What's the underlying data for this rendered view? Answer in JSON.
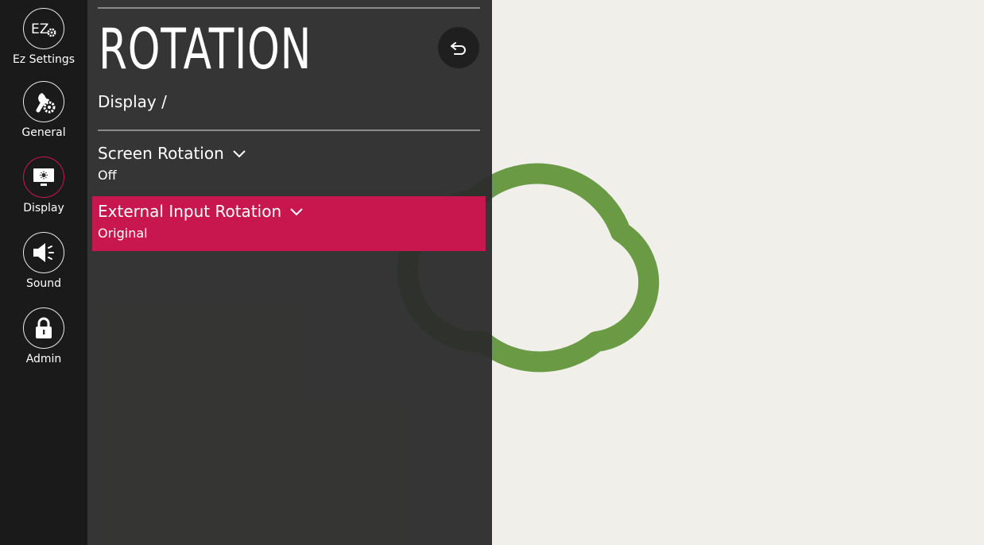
{
  "sidebar": {
    "items": [
      {
        "label": "Ez Settings",
        "icon": "ez-settings-icon",
        "active": false
      },
      {
        "label": "General",
        "icon": "wrench-gear-icon",
        "active": false
      },
      {
        "label": "Display",
        "icon": "monitor-icon",
        "active": true
      },
      {
        "label": "Sound",
        "icon": "speaker-icon",
        "active": false
      },
      {
        "label": "Admin",
        "icon": "lock-icon",
        "active": false
      }
    ]
  },
  "panel": {
    "title": "ROTATION",
    "breadcrumb": "Display /",
    "back_icon": "back-arrow-icon",
    "settings": [
      {
        "label": "Screen Rotation",
        "value": "Off",
        "selected": false
      },
      {
        "label": "External Input Rotation",
        "value": "Original",
        "selected": true
      }
    ]
  },
  "colors": {
    "accent": "#c8174f",
    "sidebar_bg": "#1a1a1a",
    "panel_bg": "#2d2d2d",
    "background": "#f0efea",
    "cloud": "#6a9a44"
  }
}
